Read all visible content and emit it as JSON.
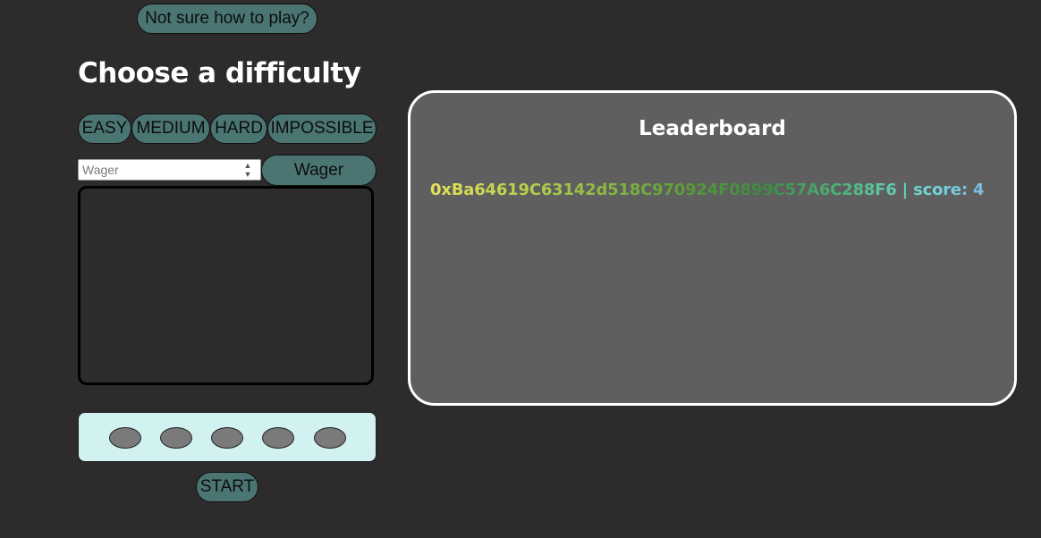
{
  "help": {
    "label": "Not sure how to play?"
  },
  "title": "Choose a difficulty",
  "difficulties": [
    "EASY",
    "MEDIUM",
    "HARD",
    "IMPOSSIBLE"
  ],
  "wager": {
    "placeholder": "Wager",
    "value": "",
    "button_label": "Wager"
  },
  "guess_slots": [
    {
      "color": "#7a7a7a"
    },
    {
      "color": "#7a7a7a"
    },
    {
      "color": "#7a7a7a"
    },
    {
      "color": "#7a7a7a"
    },
    {
      "color": "#7a7a7a"
    }
  ],
  "start": {
    "label": "START"
  },
  "leaderboard": {
    "title": "Leaderboard",
    "entries": [
      {
        "address": "0xBa64619C63142d518C970924F0899C57A6C288F6",
        "separator": " | ",
        "score_label": "score: ",
        "score": 4
      }
    ]
  },
  "colors": {
    "background": "#2d2b2c",
    "button": "#4a7573",
    "guess_panel": "#d2f2f1",
    "leaderboard_bg": "#5f5f5f",
    "slot_empty": "#7a7a7a"
  }
}
